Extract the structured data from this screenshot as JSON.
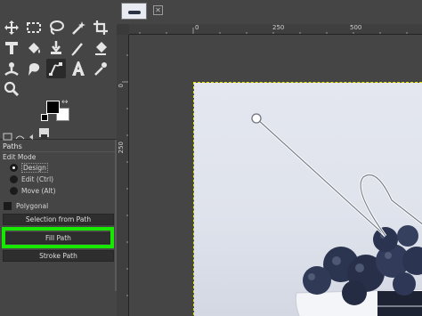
{
  "toolbox": {
    "tools": [
      {
        "name": "move-tool-icon"
      },
      {
        "name": "rect-select-tool-icon"
      },
      {
        "name": "free-select-tool-icon"
      },
      {
        "name": "fuzzy-select-tool-icon"
      },
      {
        "name": "crop-tool-icon"
      },
      {
        "name": "text-transform-tool-icon"
      },
      {
        "name": "bucket-fill-tool-icon"
      },
      {
        "name": "paintbrush-tool-icon"
      },
      {
        "name": "eraser-tool-icon"
      },
      {
        "name": "clone-tool-icon"
      },
      {
        "name": "smudge-tool-icon"
      },
      {
        "name": "paths-tool-icon"
      },
      {
        "name": "text-tool-icon"
      },
      {
        "name": "color-picker-tool-icon"
      },
      {
        "name": "zoom-tool-icon"
      }
    ],
    "colors": {
      "foreground": "#000000",
      "background": "#ffffff"
    }
  },
  "paths_panel": {
    "title": "Paths",
    "edit_mode_label": "Edit Mode",
    "modes": [
      {
        "label": "Design",
        "selected": true
      },
      {
        "label": "Edit (Ctrl)",
        "selected": false
      },
      {
        "label": "Move (Alt)",
        "selected": false
      }
    ],
    "polygonal_label": "Polygonal",
    "buttons": {
      "selection_from_path": "Selection from Path",
      "fill_path": "Fill Path",
      "stroke_path": "Stroke Path"
    },
    "highlight_color": "#18e700"
  },
  "rulers": {
    "horizontal_labels": [
      "0",
      "250",
      "500"
    ],
    "vertical_labels": [
      "0",
      "250"
    ]
  },
  "colors": {
    "ui_background": "#454545",
    "selection_border": "#e3e300"
  }
}
